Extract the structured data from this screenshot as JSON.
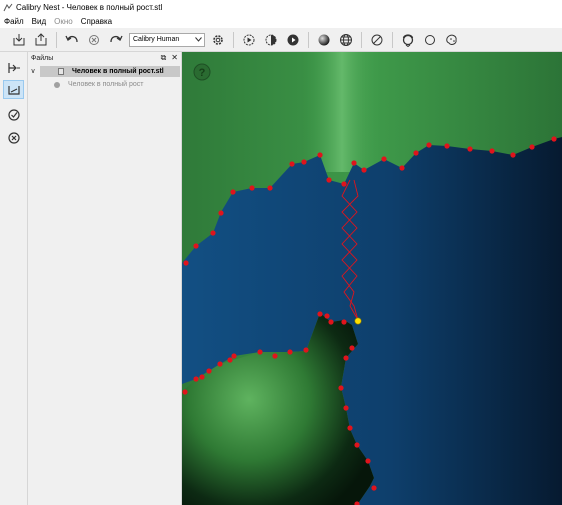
{
  "window": {
    "title": "Calibry Nest - Человек в полный рост.stl"
  },
  "menu": {
    "items": [
      {
        "label": "Файл",
        "enabled": true
      },
      {
        "label": "Вид",
        "enabled": true
      },
      {
        "label": "Окно",
        "enabled": false
      },
      {
        "label": "Справка",
        "enabled": true
      }
    ]
  },
  "toolbar": {
    "profile_select": {
      "value": "Calibry Human"
    }
  },
  "files_panel": {
    "title": "Файлы",
    "tree": {
      "file": "Человек в полный рост.stl",
      "child": "Человек в полный рост"
    }
  },
  "viewport": {
    "help_icon": "question-mark",
    "colors": {
      "surface_green": "#3f8f47",
      "cavity_blue": "#0e4a7a",
      "markers": "#e0141c",
      "handle": "#ffe000",
      "path": "#e0141c"
    }
  }
}
